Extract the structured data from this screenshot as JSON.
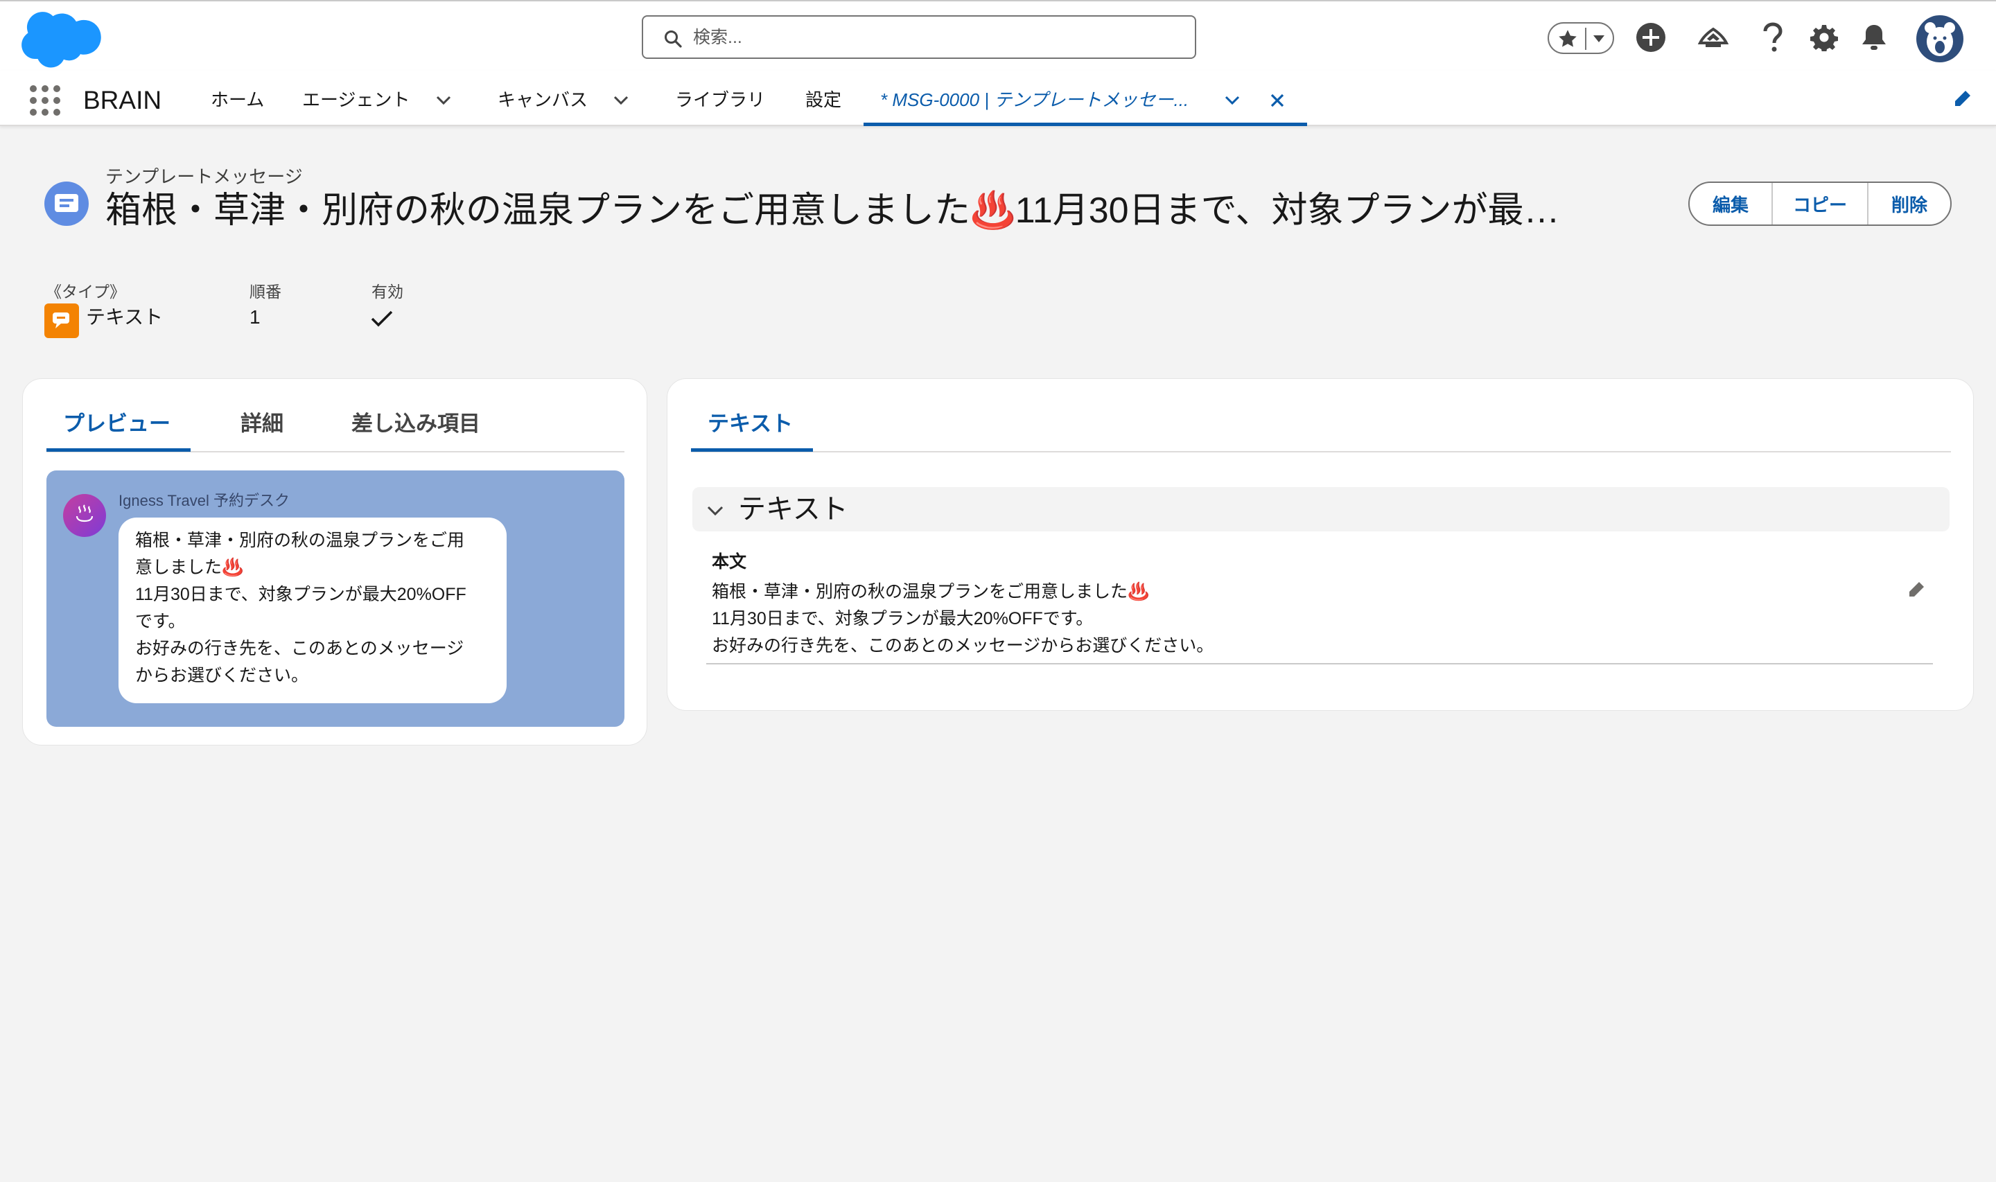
{
  "header": {
    "search_placeholder": "検索...",
    "icons": [
      "favorites-star-icon",
      "add-icon",
      "trailhead-icon",
      "help-icon",
      "setup-gear-icon",
      "notifications-bell-icon",
      "user-avatar"
    ]
  },
  "nav": {
    "app_name": "BRAIN",
    "items": [
      {
        "label": "ホーム",
        "has_menu": false
      },
      {
        "label": "エージェント",
        "has_menu": true
      },
      {
        "label": "キャンバス",
        "has_menu": true
      },
      {
        "label": "ライブラリ",
        "has_menu": false
      },
      {
        "label": "設定",
        "has_menu": false
      }
    ],
    "active_tab_label": "* MSG-0000 | テンプレートメッセー..."
  },
  "record": {
    "object_label": "テンプレートメッセージ",
    "title": "箱根・草津・別府の秋の温泉プランをご用意しました♨️11月30日まで、対象プランが最…",
    "actions": {
      "edit": "編集",
      "copy": "コピー",
      "delete": "削除"
    },
    "highlights": {
      "type_label": "《タイプ》",
      "type_value": "テキスト",
      "order_label": "順番",
      "order_value": "1",
      "active_label": "有効",
      "active_checked": true
    }
  },
  "left_card": {
    "tabs": [
      "プレビュー",
      "詳細",
      "差し込み項目"
    ],
    "active_tab": 0,
    "preview": {
      "sender": "Igness Travel 予約デスク",
      "bubble_lines": [
        "箱根・草津・別府の秋の温泉プランをご用",
        "意しました♨️",
        "11月30日まで、対象プランが最大20%OFF",
        "です。",
        "お好みの行き先を、このあとのメッセージ",
        "からお選びください。"
      ]
    }
  },
  "right_card": {
    "tabs": [
      "テキスト"
    ],
    "section_title": "テキスト",
    "field_label": "本文",
    "field_lines": [
      "箱根・草津・別府の秋の温泉プランをご用意しました♨️",
      "11月30日まで、対象プランが最大20%OFFです。",
      "お好みの行き先を、このあとのメッセージからお選びください。"
    ]
  },
  "colors": {
    "brand_blue": "#0b5cab",
    "salesforce_cloud": "#1b96ff",
    "record_icon": "#5f8ce2",
    "type_icon": "#f38303",
    "preview_bg": "#8ba9d7"
  }
}
